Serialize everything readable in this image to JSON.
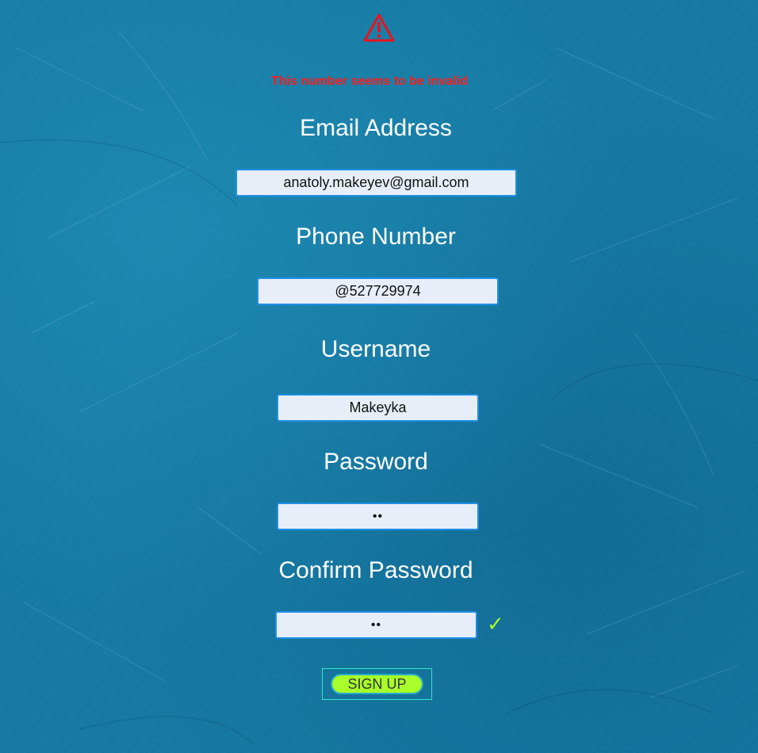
{
  "error": {
    "icon": "warning-triangle-icon",
    "message": "This number seems to be invalid",
    "color": "#ff1a1a"
  },
  "form": {
    "email": {
      "label": "Email Address",
      "value": "anatoly.makeyev@gmail.com"
    },
    "phone": {
      "label": "Phone Number",
      "value": "@527729974"
    },
    "username": {
      "label": "Username",
      "value": "Makeyka"
    },
    "password": {
      "label": "Password",
      "value": "••"
    },
    "confirm_password": {
      "label": "Confirm Password",
      "value": "••",
      "status_icon": "checkmark-icon",
      "status_glyph": "✓"
    },
    "submit_label": "SIGN UP"
  },
  "colors": {
    "background": "#167aa3",
    "field_border": "#1e8fe6",
    "field_fill": "#e8eef8",
    "accent": "#a8ff2a",
    "label_text": "#ffffff"
  }
}
